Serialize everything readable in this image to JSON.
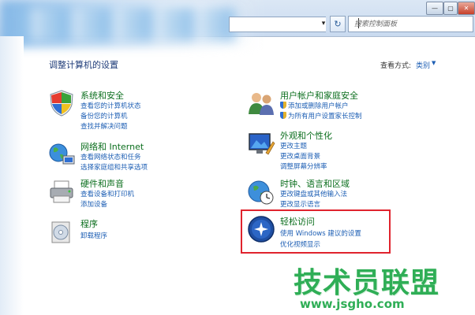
{
  "toolbar": {
    "address_dropdown_glyph": "▾",
    "refresh_glyph": "↻",
    "search_placeholder": "搜索控制面板",
    "window_buttons": {
      "minimize": "—",
      "maximize": "▢",
      "close": "✕"
    }
  },
  "main": {
    "heading": "调整计算机的设置",
    "view_label": "查看方式:",
    "view_value": "类别",
    "view_caret": "▼",
    "categories": [
      {
        "title": "系统和安全",
        "icon": "shield-flag-icon",
        "links": [
          "查看您的计算机状态",
          "备份您的计算机",
          "查找并解决问题"
        ]
      },
      {
        "title": "网络和 Internet",
        "icon": "network-globe-icon",
        "links": [
          "查看网络状态和任务",
          "选择家庭组和共享选项"
        ]
      },
      {
        "title": "硬件和声音",
        "icon": "printer-icon",
        "links": [
          "查看设备和打印机",
          "添加设备"
        ]
      },
      {
        "title": "程序",
        "icon": "program-disc-icon",
        "links": [
          "卸载程序"
        ]
      },
      {
        "title": "用户帐户和家庭安全",
        "icon": "users-icon",
        "links": [
          "添加或删除用户帐户",
          "为所有用户设置家长控制"
        ]
      },
      {
        "title": "外观和个性化",
        "icon": "display-paint-icon",
        "links": [
          "更改主题",
          "更改桌面背景",
          "调整屏幕分辨率"
        ]
      },
      {
        "title": "时钟、语言和区域",
        "icon": "clock-globe-icon",
        "links": [
          "更改键盘或其他输入法",
          "更改显示语言"
        ]
      },
      {
        "title": "轻松访问",
        "icon": "ease-of-access-icon",
        "links": [
          "使用 Windows 建议的设置",
          "优化视频显示"
        ]
      }
    ]
  },
  "watermark": {
    "brand": "技术员联盟",
    "url": "www.jsgho.com"
  },
  "colors": {
    "highlight_border": "#e0232d",
    "category_title": "#0b6e1d",
    "link": "#1e5fb4",
    "watermark": "#2fae56"
  }
}
